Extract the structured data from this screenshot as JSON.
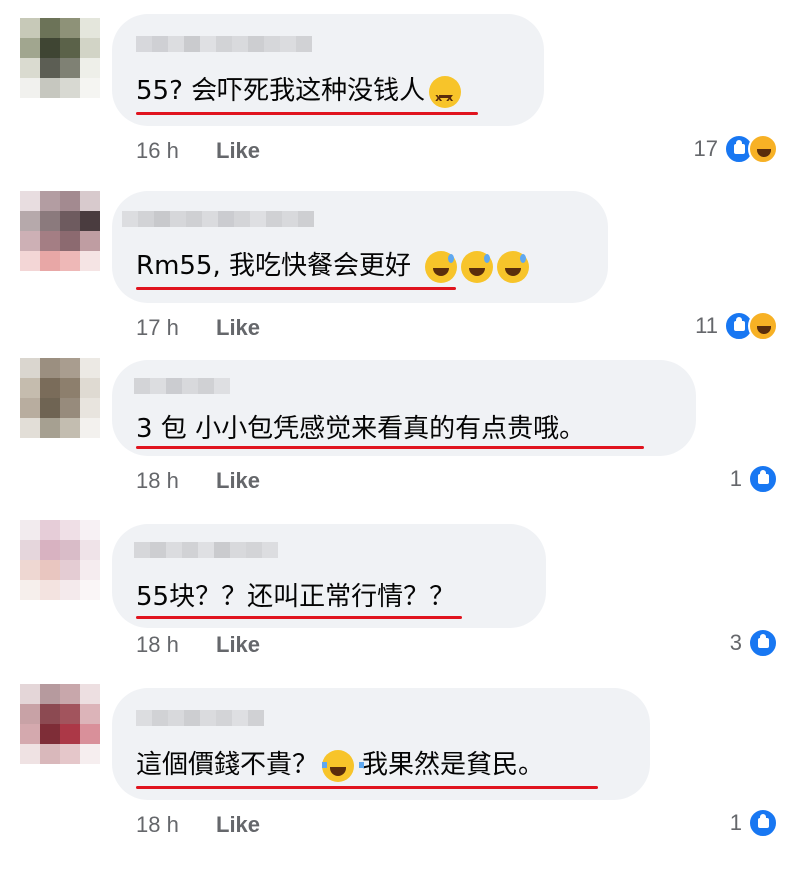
{
  "comments": [
    {
      "text": "55? 会吓死我这种没钱人",
      "emoji": [
        "persevering-face"
      ],
      "time": "16 h",
      "like_label": "Like",
      "reaction_count": "17",
      "reactions": [
        "like",
        "haha"
      ]
    },
    {
      "text": "Rm55, 我吃快餐会更好",
      "emoji": [
        "grinning-sweat",
        "grinning-sweat",
        "grinning-sweat"
      ],
      "time": "17 h",
      "like_label": "Like",
      "reaction_count": "11",
      "reactions": [
        "like",
        "haha"
      ]
    },
    {
      "text": "3 包 小小包凭感觉来看真的有点贵哦。",
      "emoji": [],
      "time": "18 h",
      "like_label": "Like",
      "reaction_count": "1",
      "reactions": [
        "like"
      ]
    },
    {
      "text": "55块？？还叫正常行情？？",
      "emoji": [],
      "time": "18 h",
      "like_label": "Like",
      "reaction_count": "3",
      "reactions": [
        "like"
      ]
    },
    {
      "text_before": "這個價錢不貴？",
      "text_after": "我果然是貧民。",
      "emoji": [
        "tears-of-joy"
      ],
      "time": "18 h",
      "like_label": "Like",
      "reaction_count": "1",
      "reactions": [
        "like"
      ]
    }
  ],
  "colors": {
    "bubble": "#f0f2f5",
    "meta": "#65676b",
    "underline": "#e0141e",
    "like_blue": "#1877f2",
    "haha_yellow": "#f7b125"
  }
}
